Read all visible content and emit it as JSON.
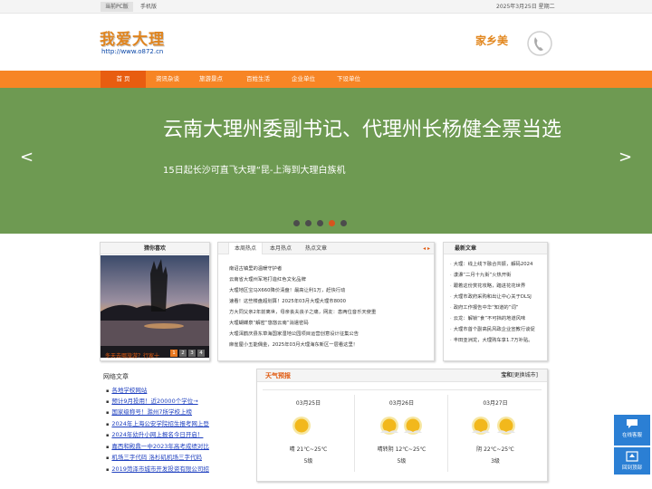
{
  "topbar": {
    "pc_label": "当前PC版",
    "mobile_label": "手机版",
    "date": "2025年3月25日 星期二"
  },
  "header": {
    "logo_text": "我爱大理",
    "logo_url": "http://www.o872.cn",
    "badge_text": "家乡美"
  },
  "nav": {
    "items": [
      {
        "label": "首 页",
        "active": true
      },
      {
        "label": "资讯杂谈"
      },
      {
        "label": "旅游景点"
      },
      {
        "label": "百姓生活"
      },
      {
        "label": "企业单位"
      },
      {
        "label": "下设单位"
      }
    ]
  },
  "banner": {
    "title": "云南大理州委副书记、代理州长杨健全票当选",
    "subtitle": "15日起长沙可直飞大理“昆-上海到大理白族机",
    "prev": "<",
    "next": ">",
    "active_dot": 4,
    "dot_count": 5
  },
  "guess": {
    "title": "猜你喜欢",
    "caption": "冬天去哪旅游？行家十",
    "pages": [
      "1",
      "2",
      "3",
      "4"
    ],
    "active_page": 0
  },
  "hot": {
    "tabs": [
      "本周热点",
      "本月热点",
      "热点文章"
    ],
    "active_tab": 0,
    "arrows": "◂ ▸",
    "items": [
      "南诏古镇里的温暖守护者",
      "云南省大理州军地打造红色文化品牌",
      "大理地区宝马X660降价清盘！最高让利1万，赶快行动",
      "速看！这些楼盘超划算！2025年03月大理大理市8000",
      "方大同父亲2年前离世，母亲丧夫丧子之痛，网友：患两位音乐天使重",
      "大理蝴蝶泉“解密”悠悠云南”消遣密码",
      "大理洱鹤庆县东草海国家湿地公园项目运营创意设计征集公告",
      "麻雀屋小五能偶金，2025年03月大理海东新区一层看这里！"
    ]
  },
  "latest": {
    "title": "最新文章",
    "items": [
      "大理：线上线下融合共振，解码2024",
      "漾濞“二月十九街”火热开街",
      "跟着这份赏花攻略，踏进花花世界",
      "大理市政府采购和出让中心关于DLSJ",
      "政府工作报告中华“知道的”词”",
      "云龙：解锁“食”不可挡的地道风味",
      "大理市首个副高民风政企业宣教行谈促",
      "丰田亚洲龙，大理购车享1.7万补贴。"
    ]
  },
  "links": {
    "title": "网络文章",
    "items": [
      "各地学校网站",
      "预计9月投用！近20000个学位→",
      "国家级称号！滁州7所学校上榜",
      "2024年上海公安学院招生报考网上登",
      "2024年幼升小网上报名今日开启！",
      "嘉西和殿鼎一中2023年高考成绩对比",
      "机场三字代码 洛杉矶机场三字代码",
      "2019菏泽市城市开发投资有限公司招"
    ]
  },
  "weather": {
    "title": "天气预报",
    "city": "宝和",
    "change": "[更换城市]",
    "days": [
      {
        "date": "03月25日",
        "cond": "晴 21℃~25℃",
        "wind": "5级",
        "suns": 2
      },
      {
        "date": "03月26日",
        "cond": "晴转阴 12℃~25℃",
        "wind": "5级",
        "suns": 2
      },
      {
        "date": "03月27日",
        "cond": "阴 22℃~25℃",
        "wind": "3级",
        "suns": 2
      }
    ]
  },
  "side": {
    "consult": "在线客服",
    "top": "回到顶部"
  },
  "colors": {
    "nav": "#f78525",
    "nav_active": "#e85d10",
    "banner": "#6e9a52",
    "accent": "#e05a10",
    "side": "#2b7fd4"
  }
}
